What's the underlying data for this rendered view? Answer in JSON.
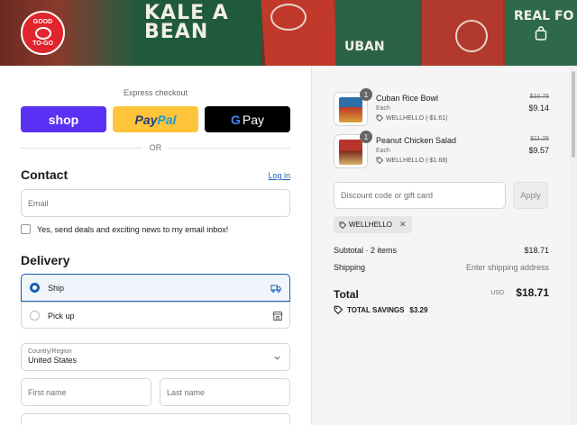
{
  "brand": {
    "logo_top": "GOOD",
    "logo_bottom": "TO-GO"
  },
  "hero": {
    "text1": "KALE A\nBEAN",
    "text2": "REAL FO",
    "text3": "UBAN"
  },
  "express": {
    "title": "Express checkout",
    "shop_label": "shop",
    "paypal_label_1": "Pay",
    "paypal_label_2": "Pal",
    "gpay_g": "G",
    "gpay_label": "Pay",
    "or_label": "OR"
  },
  "contact": {
    "heading": "Contact",
    "login_link": "Log in",
    "email_placeholder": "Email",
    "newsletter_label": "Yes, send deals and exciting news to my email inbox!"
  },
  "delivery": {
    "heading": "Delivery",
    "options": [
      {
        "label": "Ship",
        "selected": true
      },
      {
        "label": "Pick up",
        "selected": false
      }
    ],
    "country_label": "Country/Region",
    "country_value": "United States",
    "first_name_placeholder": "First name",
    "last_name_placeholder": "Last name"
  },
  "cart": {
    "items": [
      {
        "name": "Cuban Rice Bowl",
        "qty": "1",
        "unit": "Each",
        "discount": "WELLHELLO (-$1.61)",
        "old_price": "$10.75",
        "price": "$9.14"
      },
      {
        "name": "Peanut Chicken Salad",
        "qty": "1",
        "unit": "Each",
        "discount": "WELLHELLO (-$1.68)",
        "old_price": "$11.25",
        "price": "$9.57"
      }
    ],
    "discount_placeholder": "Discount code or gift card",
    "apply_label": "Apply",
    "applied_code": "WELLHELLO",
    "subtotal_label": "Subtotal · 2 items",
    "subtotal_value": "$18.71",
    "shipping_label": "Shipping",
    "shipping_value": "Enter shipping address",
    "total_label": "Total",
    "currency": "USD",
    "total_value": "$18.71",
    "savings_label": "TOTAL SAVINGS",
    "savings_value": "$3.29"
  },
  "colors": {
    "accent": "#1a5fb4",
    "shop": "#5a31f4",
    "paypal": "#ffc439",
    "brand_red": "#e0252c"
  }
}
